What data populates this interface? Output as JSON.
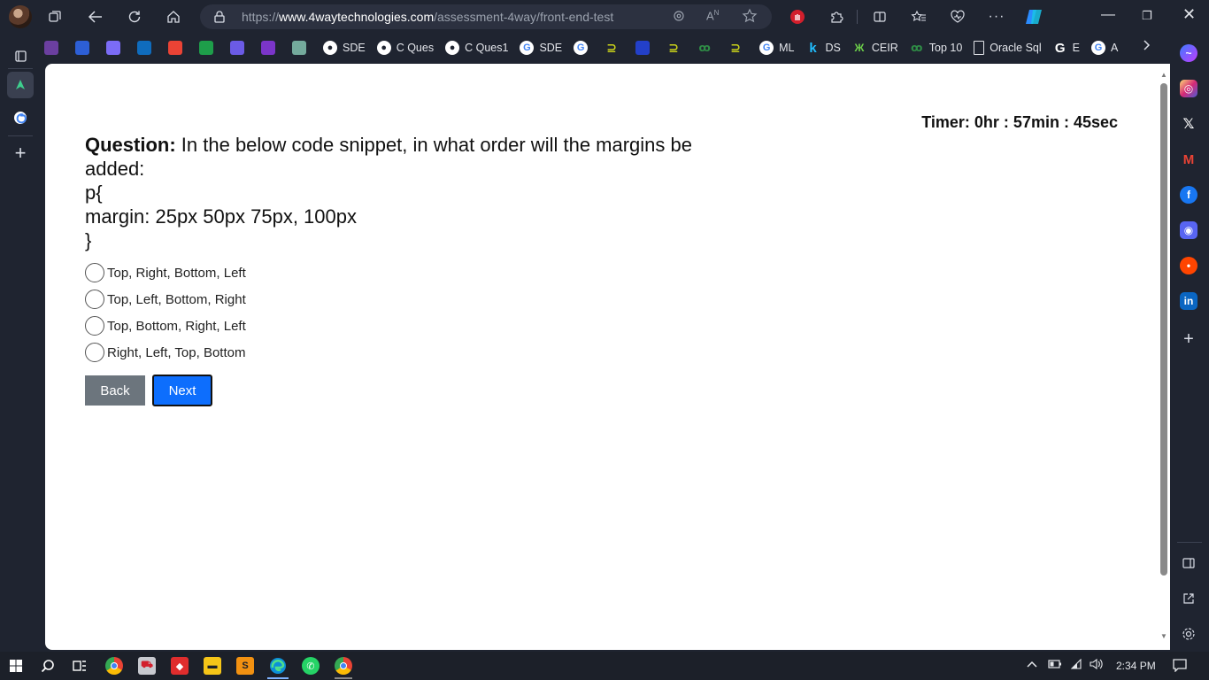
{
  "browser": {
    "url_prefix": "https://",
    "url_domain": "www.4waytechnologies.com",
    "url_path": "/assessment-4way/front-end-test",
    "bookmarks": [
      {
        "label": "",
        "icon": "bookmark-icon-1",
        "color": "#6b3fa0"
      },
      {
        "label": "",
        "icon": "bookmark-icon-2",
        "color": "#2d5fd6"
      },
      {
        "label": "",
        "icon": "bookmark-icon-3",
        "color": "#7b6cf6"
      },
      {
        "label": "",
        "icon": "outlook-icon",
        "color": "#0f6cbd"
      },
      {
        "label": "",
        "icon": "gmail-icon",
        "color": "#ea4335"
      },
      {
        "label": "",
        "icon": "sheets-icon",
        "color": "#1e9e4a"
      },
      {
        "label": "",
        "icon": "bookmark-icon-7",
        "color": "#6b5be6"
      },
      {
        "label": "",
        "icon": "bookmark-icon-8",
        "color": "#7b35c9"
      },
      {
        "label": "",
        "icon": "chatgpt-icon",
        "color": "#74aa9c"
      },
      {
        "label": "SDE",
        "icon": "github-icon",
        "color": "#ffffff"
      },
      {
        "label": "C Ques",
        "icon": "github-icon",
        "color": "#ffffff"
      },
      {
        "label": "C Ques1",
        "icon": "github-icon",
        "color": "#ffffff"
      },
      {
        "label": "SDE",
        "icon": "google-icon",
        "color": "#ffffff"
      },
      {
        "label": "",
        "icon": "google-icon",
        "color": "#ffffff"
      },
      {
        "label": "",
        "icon": "bookmark-icon-g",
        "color": "#c9d11a"
      },
      {
        "label": "",
        "icon": "bookmark-icon-blue",
        "color": "#2340c9"
      },
      {
        "label": "",
        "icon": "bookmark-icon-g2",
        "color": "#c9d11a"
      },
      {
        "label": "",
        "icon": "gfg-icon",
        "color": "#2f8d46"
      },
      {
        "label": "",
        "icon": "bookmark-icon-g3",
        "color": "#c9d11a"
      },
      {
        "label": "ML",
        "icon": "google-icon",
        "color": "#ffffff"
      },
      {
        "label": "DS",
        "icon": "k-icon",
        "color": "#20beff"
      },
      {
        "label": "CEIR",
        "icon": "ceir-icon",
        "color": "#6ccf4a"
      },
      {
        "label": "Top 10",
        "icon": "gfg-icon",
        "color": "#2f8d46"
      },
      {
        "label": "Oracle Sql",
        "icon": "page-icon",
        "color": "#e4e6eb"
      },
      {
        "label": "E",
        "icon": "google-g-icon",
        "color": "#ffffff"
      },
      {
        "label": "A",
        "icon": "google-icon",
        "color": "#ffffff"
      }
    ]
  },
  "test": {
    "timer": "Timer: 0hr : 57min : 45sec",
    "question_label": "Question:",
    "question_text": " In the below code snippet, in what order will the margins be added:",
    "code_lines": [
      "p{",
      "margin: 25px 50px 75px, 100px",
      "}"
    ],
    "options": [
      "Top, Right, Bottom, Left",
      "Top, Left, Bottom, Right",
      "Top, Bottom, Right, Left",
      "Right, Left, Top, Bottom"
    ],
    "back_label": "Back",
    "next_label": "Next"
  },
  "taskbar": {
    "time": "2:34 PM"
  },
  "colors": {
    "next_button": "#0d6efd",
    "back_button": "#6c757d",
    "browser_chrome": "#1f2430"
  }
}
